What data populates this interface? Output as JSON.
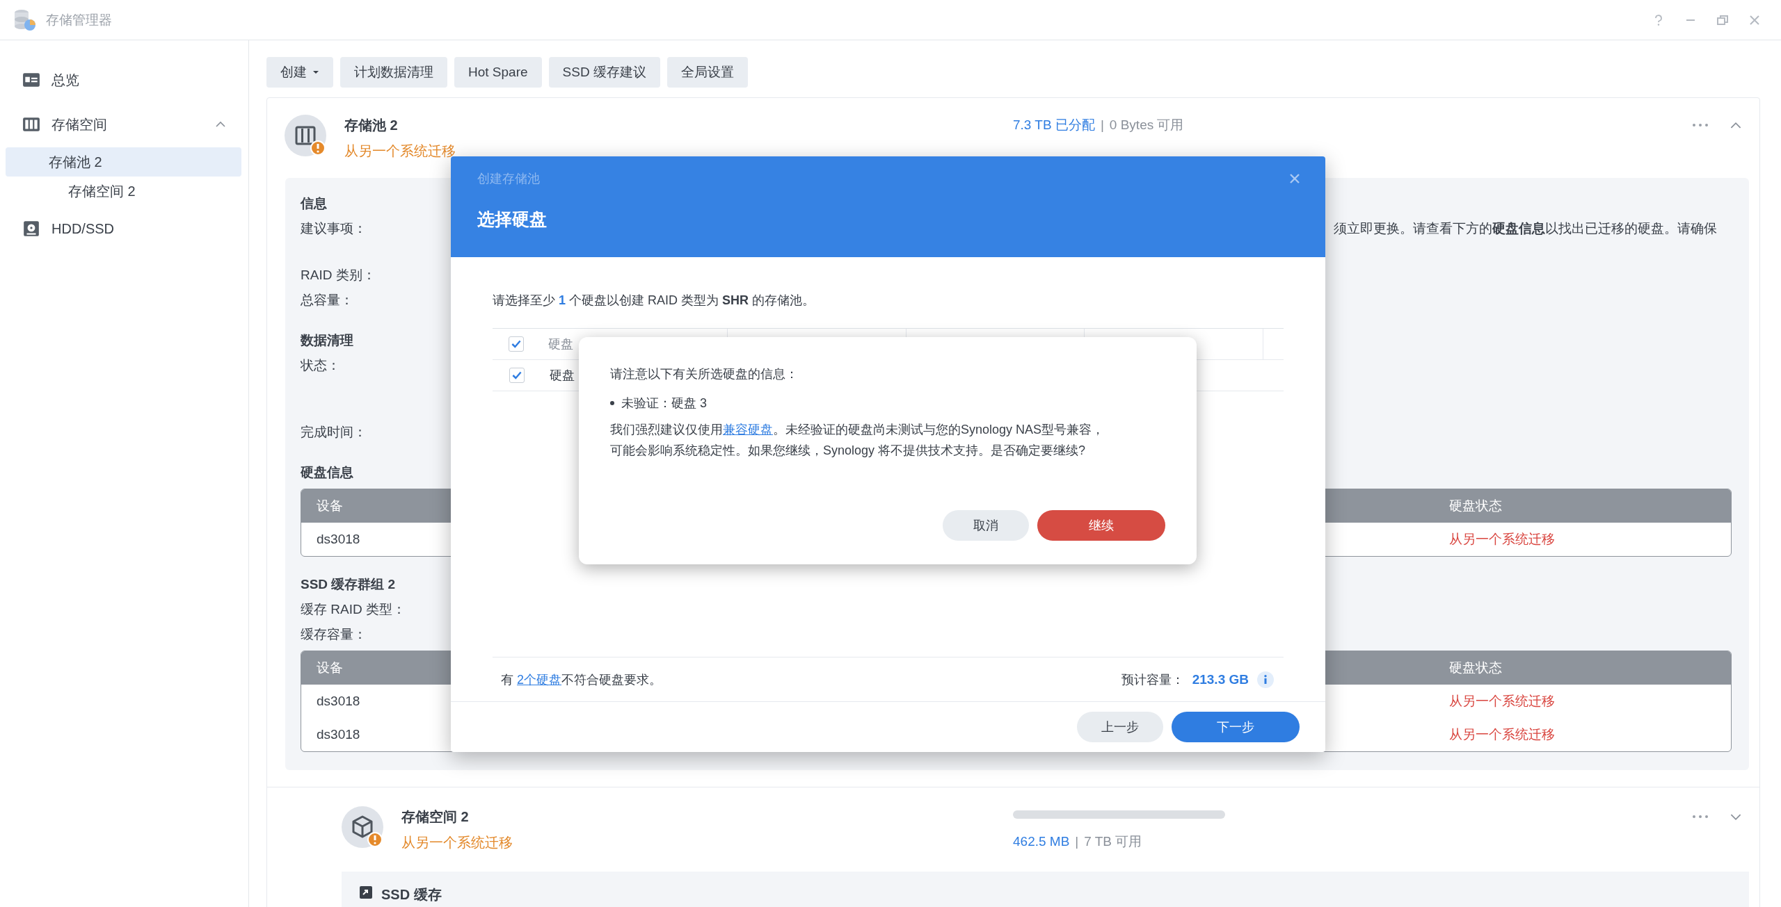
{
  "window": {
    "title": "存储管理器"
  },
  "sidebar": {
    "items": [
      {
        "label": "总览",
        "selected": false
      },
      {
        "label": "存储空间",
        "selected": false,
        "expanded": true,
        "children": [
          {
            "label": "存储池 2",
            "selected": true,
            "children": [
              {
                "label": "存储空间 2",
                "selected": false
              }
            ]
          }
        ]
      },
      {
        "label": "HDD/SSD",
        "selected": false
      }
    ]
  },
  "toolbar": {
    "buttons": [
      {
        "label": "创建",
        "dropdown": true
      },
      {
        "label": "计划数据清理",
        "dropdown": false
      },
      {
        "label": "Hot Spare",
        "dropdown": false
      },
      {
        "label": "SSD 缓存建议",
        "dropdown": false
      },
      {
        "label": "全局设置",
        "dropdown": false
      }
    ]
  },
  "pool": {
    "name": "存储池 2",
    "status": "从另一个系统迁移",
    "allocated": "7.3 TB 已分配",
    "separator": "|",
    "available": "0 Bytes 可用",
    "expanded": true,
    "sections": [
      {
        "heading": "信息",
        "rows": [
          {
            "label": "建议事项：",
            "value": "须立即更换。请查看下方的**硬盘信息**以找出已迁移的硬盘。请确保"
          },
          {
            "label": "RAID 类别："
          },
          {
            "label": "总容量："
          }
        ]
      },
      {
        "heading": "数据清理",
        "rows": [
          {
            "label": "状态："
          },
          {
            "label": "完成时间："
          }
        ]
      },
      {
        "heading": "硬盘信息",
        "table": {
          "columns": [
            "设备",
            "硬盘状态"
          ],
          "rows": [
            [
              "ds3018",
              "从另一个系统迁移"
            ]
          ]
        }
      },
      {
        "heading": "SSD 缓存群组 2",
        "rows": [
          {
            "label": "缓存 RAID 类型："
          },
          {
            "label": "缓存容量："
          }
        ],
        "table": {
          "columns": [
            "设备",
            "硬盘状态"
          ],
          "rows": [
            [
              "ds3018",
              "从另一个系统迁移"
            ],
            [
              "ds3018",
              "从另一个系统迁移"
            ]
          ]
        }
      }
    ]
  },
  "volume": {
    "name": "存储空间 2",
    "status": "从另一个系统迁移",
    "level": 0.0,
    "used": "462.5 MB",
    "separator": "|",
    "available": "7 TB 可用",
    "expanded": false
  },
  "ssd_cache": {
    "label": "SSD 缓存"
  },
  "dialog": {
    "window_title": "创建存储池",
    "title": "选择硬盘",
    "instruction": "请选择至少 **1** 个硬盘以创建 RAID 类型为 **SHR** 的存储池。",
    "table": {
      "header": {
        "checked": true,
        "column_1": "硬盘"
      },
      "rows": [
        {
          "checked": true,
          "column_1": "硬盘"
        }
      ]
    },
    "note": {
      "before": "有 ",
      "link": "2个硬盘",
      "after": "不符合硬盘要求。"
    },
    "capacity_label": "预计容量：",
    "capacity": "213.3 GB",
    "buttons": [
      {
        "label": "上一步",
        "primary": false
      },
      {
        "label": "下一步",
        "primary": true
      }
    ]
  },
  "alert": {
    "intro": "请注意以下有关所选硬盘的信息：",
    "bullets": [
      "未验证：硬盘 3"
    ],
    "message_before": "我们强烈建议仅使用",
    "link": "兼容硬盘",
    "message_after": "。未经验证的硬盘尚未测试与您的Synology NAS型号兼容，可能会影响系统稳定性。如果您继续，Synology 将不提供技术支持。是否确定要继续?",
    "buttons": [
      {
        "label": "取消",
        "kind": "secondary"
      },
      {
        "label": "继续",
        "kind": "danger"
      }
    ]
  }
}
